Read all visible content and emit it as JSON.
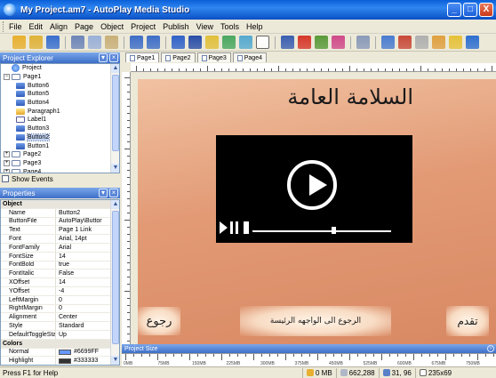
{
  "window": {
    "title": "My Project.am7 - AutoPlay Media Studio",
    "buttons": [
      "_",
      "□",
      "X"
    ]
  },
  "menu": [
    {
      "label": "File",
      "name": "menu-file"
    },
    {
      "label": "Edit",
      "name": "menu-edit"
    },
    {
      "label": "Align",
      "name": "menu-align"
    },
    {
      "label": "Page",
      "name": "menu-page"
    },
    {
      "label": "Object",
      "name": "menu-object"
    },
    {
      "label": "Project",
      "name": "menu-project"
    },
    {
      "label": "Publish",
      "name": "menu-publish"
    },
    {
      "label": "View",
      "name": "menu-view"
    },
    {
      "label": "Tools",
      "name": "menu-tools"
    },
    {
      "label": "Help",
      "name": "menu-help"
    }
  ],
  "toolbar": [
    {
      "name": "new-project-icon",
      "color": "#e8b030"
    },
    {
      "name": "open-project-icon",
      "color": "#e0b23a"
    },
    {
      "name": "save-icon",
      "color": "#3a6fcf"
    },
    {
      "sep": true
    },
    {
      "name": "cut-icon",
      "color": "#6e86b8"
    },
    {
      "name": "copy-icon",
      "color": "#9ab0d8"
    },
    {
      "name": "paste-icon",
      "color": "#c9b07a"
    },
    {
      "sep": true
    },
    {
      "name": "undo-icon",
      "color": "#3f6ec8"
    },
    {
      "name": "redo-icon",
      "color": "#3f6ec8"
    },
    {
      "sep": true
    },
    {
      "name": "add-button-icon",
      "color": "#3162c8"
    },
    {
      "name": "add-label-icon",
      "color": "#2a4ea8"
    },
    {
      "name": "add-paragraph-icon",
      "color": "#e1c03c"
    },
    {
      "name": "add-image-icon",
      "color": "#4aa860"
    },
    {
      "name": "add-flash-icon",
      "color": "#55aad0"
    },
    {
      "name": "add-input-icon",
      "color": "#ffffff"
    },
    {
      "sep": true
    },
    {
      "name": "add-video-icon",
      "color": "#3b5fb0"
    },
    {
      "name": "add-web-icon",
      "color": "#d6382a"
    },
    {
      "name": "add-slideshow-icon",
      "color": "#5a9a3a"
    },
    {
      "name": "add-plugin-icon",
      "color": "#d04a8a"
    },
    {
      "sep": true
    },
    {
      "name": "zoom-icon",
      "color": "#8a9ab8"
    },
    {
      "sep": true
    },
    {
      "name": "page-properties-icon",
      "color": "#4a7cd0"
    },
    {
      "name": "project-settings-icon",
      "color": "#c84a3a"
    },
    {
      "name": "preview-icon",
      "color": "#b0b0b0"
    },
    {
      "name": "build-icon",
      "color": "#e0a040"
    },
    {
      "name": "publish-icon",
      "color": "#e6c23a"
    },
    {
      "name": "help-icon",
      "color": "#2f6fd0"
    }
  ],
  "explorer": {
    "title": "Project Explorer",
    "items": [
      {
        "label": "Project",
        "level": 0,
        "toggle": "",
        "icon": "project-icon",
        "cls": "ic-proj"
      },
      {
        "label": "Page1",
        "level": 0,
        "toggle": "−",
        "icon": "page-icon",
        "cls": "ic-page"
      },
      {
        "label": "Button6",
        "level": 1,
        "toggle": "",
        "icon": "button-icon",
        "cls": "ic-btn"
      },
      {
        "label": "Button5",
        "level": 1,
        "toggle": "",
        "icon": "button-icon",
        "cls": "ic-btn"
      },
      {
        "label": "Button4",
        "level": 1,
        "toggle": "",
        "icon": "button-icon",
        "cls": "ic-btn"
      },
      {
        "label": "Paragraph1",
        "level": 1,
        "toggle": "",
        "icon": "paragraph-icon",
        "cls": "ic-para"
      },
      {
        "label": "Label1",
        "level": 1,
        "toggle": "",
        "icon": "label-icon",
        "cls": "ic-label"
      },
      {
        "label": "Button3",
        "level": 1,
        "toggle": "",
        "icon": "button-icon",
        "cls": "ic-btn"
      },
      {
        "label": "Button2",
        "level": 1,
        "toggle": "",
        "icon": "button-icon",
        "cls": "ic-btn",
        "selected": true
      },
      {
        "label": "Button1",
        "level": 1,
        "toggle": "",
        "icon": "button-icon",
        "cls": "ic-btn"
      },
      {
        "label": "Page2",
        "level": 0,
        "toggle": "+",
        "icon": "page-icon",
        "cls": "ic-page"
      },
      {
        "label": "Page3",
        "level": 0,
        "toggle": "+",
        "icon": "page-icon",
        "cls": "ic-page"
      },
      {
        "label": "Page4",
        "level": 0,
        "toggle": "+",
        "icon": "page-icon",
        "cls": "ic-page"
      }
    ],
    "show_events": "Show Events"
  },
  "properties": {
    "title": "Properties",
    "rows": [
      {
        "cat": true,
        "key": "Object"
      },
      {
        "key": "Name",
        "value": "Button2"
      },
      {
        "key": "ButtonFile",
        "value": "AutoPlay\\Buttor"
      },
      {
        "key": "Text",
        "value": "Page 1 Link"
      },
      {
        "key": "Font",
        "value": "Arial, 14pt"
      },
      {
        "key": "FontFamily",
        "value": "Arial"
      },
      {
        "key": "FontSize",
        "value": "14"
      },
      {
        "key": "FontBold",
        "value": "true"
      },
      {
        "key": "FontItalic",
        "value": "False"
      },
      {
        "key": "XOffset",
        "value": "14"
      },
      {
        "key": "YOffset",
        "value": "-4"
      },
      {
        "key": "LeftMargin",
        "value": "0"
      },
      {
        "key": "RightMargin",
        "value": "0"
      },
      {
        "key": "Alignment",
        "value": "Center"
      },
      {
        "key": "Style",
        "value": "Standard"
      },
      {
        "key": "DefaultToggleSta",
        "value": "Up"
      },
      {
        "cat": true,
        "key": "Colors"
      },
      {
        "key": "Normal",
        "value": "#6699FF",
        "swatch": "#6699FF"
      },
      {
        "key": "Highlight",
        "value": "#333333",
        "swatch": "#333333"
      }
    ]
  },
  "tabs": [
    {
      "label": "Page1",
      "active": true
    },
    {
      "label": "Page2"
    },
    {
      "label": "Page3"
    },
    {
      "label": "Page4"
    }
  ],
  "page": {
    "heading": "السلامة العامة",
    "left_button": "رجوع",
    "middle_button": "الرجوع الى الواجهه الرئيسة",
    "right_button": "تقدم"
  },
  "project_size": {
    "title": "Project Size",
    "ruler_labels": [
      "0MB",
      "75MB",
      "150MB",
      "225MB",
      "300MB",
      "375MB",
      "450MB",
      "525MB",
      "600MB",
      "675MB",
      "750MB"
    ]
  },
  "status": {
    "help": "Press F1 for Help",
    "size": "0 MB",
    "memory": "662,288",
    "position": "31, 96",
    "dimensions": "235x69"
  }
}
